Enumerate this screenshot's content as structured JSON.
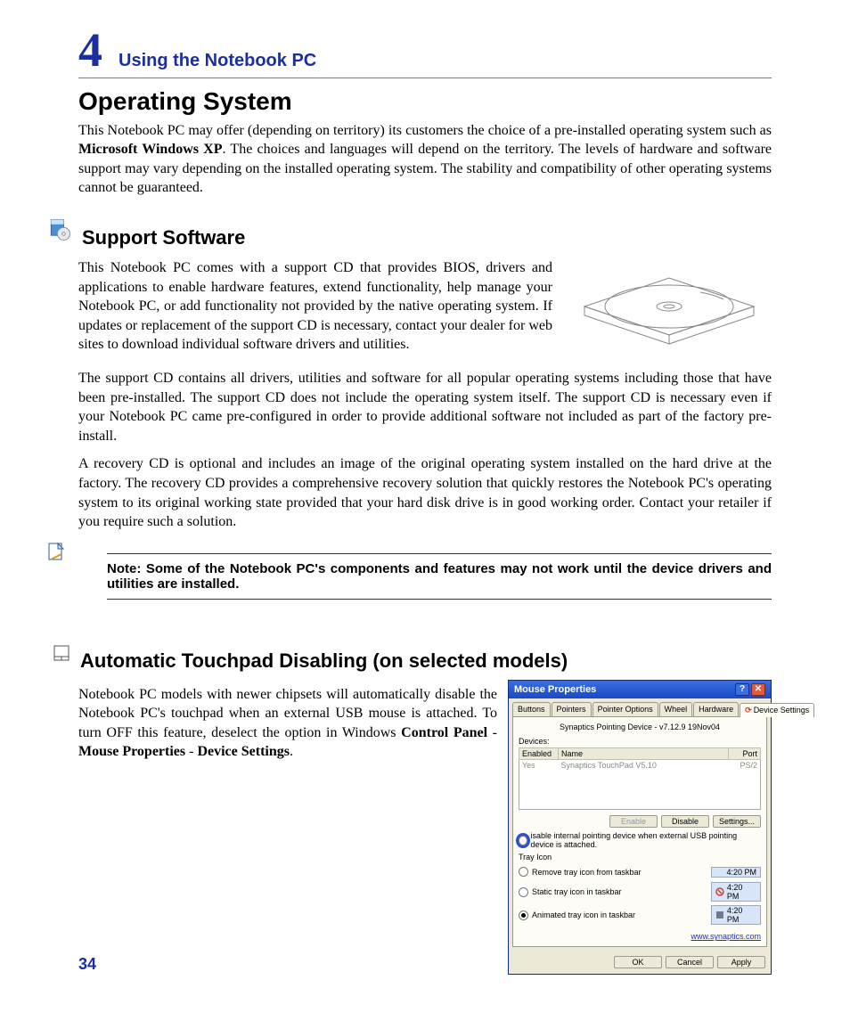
{
  "header": {
    "chapter_num": "4",
    "chapter_title": "Using the Notebook PC"
  },
  "sections": {
    "os": {
      "title": "Operating System",
      "p1a": "This Notebook PC may offer (depending on territory) its customers the choice of a pre-installed operating system such as ",
      "p1b": "Microsoft Windows XP",
      "p1c": ". The choices and languages will depend on the territory. The levels of hardware and software support may vary depending on the installed operating system. The stability and compatibility of other operating systems cannot be guaranteed."
    },
    "support": {
      "title": "Support Software",
      "p1": "This Notebook PC comes with a support CD that provides BIOS, drivers and applications to enable hardware features, extend functionality, help manage your Notebook PC, or add functionality not provided by the native operating system. If updates or replacement of the support CD is necessary, contact your dealer for web sites to download individual software drivers and utilities.",
      "p2": "The support CD contains all drivers, utilities and software for all popular operating systems including those that have been pre-installed. The support CD does not include the operating system itself. The support CD is necessary even if your Notebook PC came pre-configured in order to provide additional software not included as part of the factory pre-install.",
      "p3": "A recovery CD is optional and includes an image of the original operating system installed on the hard drive at the factory. The recovery CD provides a comprehensive recovery solution that quickly restores the Notebook PC's operating system to its original working state provided that your hard disk drive is in good working order. Contact your retailer if you require such a solution."
    },
    "note": {
      "text": "Note: Some of the Notebook PC's components and features may not work until the device drivers and utilities are installed."
    },
    "touchpad": {
      "title": "Automatic Touchpad Disabling (on selected models)",
      "p1a": "Notebook PC models with newer chipsets will automatically disable the Notebook PC's touchpad when an external USB mouse is attached. To turn OFF this feature, deselect the option in Windows ",
      "p1b": "Control Panel",
      "p1c": " - ",
      "p1d": "Mouse Properties",
      "p1e": " - ",
      "p1f": "Device Settings",
      "p1g": "."
    }
  },
  "dialog": {
    "title": "Mouse Properties",
    "help_glyph": "?",
    "close_glyph": "✕",
    "tabs": [
      "Buttons",
      "Pointers",
      "Pointer Options",
      "Wheel",
      "Hardware",
      "Device Settings"
    ],
    "active_tab": 5,
    "device_line": "Synaptics Pointing Device - v7.12.9 19Nov04",
    "devices_label": "Devices:",
    "columns": {
      "enabled": "Enabled",
      "name": "Name",
      "port": "Port"
    },
    "row": {
      "enabled": "Yes",
      "name": "Synaptics TouchPad V5.10",
      "port": "PS/2"
    },
    "buttons": {
      "enable": "Enable",
      "disable": "Disable",
      "settings": "Settings...",
      "ok": "OK",
      "cancel": "Cancel",
      "apply": "Apply"
    },
    "checkbox_label": "isable internal pointing device when external USB pointing device is attached.",
    "tray": {
      "title": "Tray Icon",
      "opt_remove": "Remove tray icon from taskbar",
      "opt_static": "Static tray icon in taskbar",
      "opt_animated": "Animated tray icon in taskbar",
      "time": "4:20 PM"
    },
    "link": "www.synaptics.com"
  },
  "page_number": "34"
}
